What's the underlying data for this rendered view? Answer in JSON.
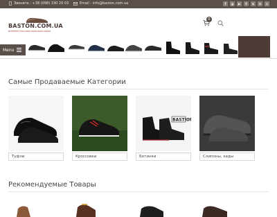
{
  "topbar": {
    "phone_text": "Звоните : +38 (098) 190 20 03",
    "email_text": "Email : info@baston.com.ua",
    "socials": [
      "facebook-icon",
      "google-plus-icon",
      "youtube-icon",
      "twitter-icon",
      "vk-icon",
      "odnoklassniki-icon",
      "instagram-icon"
    ]
  },
  "header": {
    "logo_brand": "BASTON.COM.UA",
    "logo_tagline": "ИНТЕРНЕТ-МАГАЗИН МУЖСКОЙ ОБУВИ",
    "cart_count": "0"
  },
  "strip": {
    "menu_label": "Menu"
  },
  "categories_section": {
    "title": "Самые Продаваемые Категории",
    "items": [
      {
        "label": "Туфли"
      },
      {
        "label": "Кроссовки"
      },
      {
        "label": "Ботинки"
      },
      {
        "label": "Слипоны, кеды"
      }
    ]
  },
  "products_section": {
    "title": "Рекомендуемые Товары"
  },
  "colors": {
    "topbar": "#5a4f4a",
    "accent": "#a04030"
  }
}
